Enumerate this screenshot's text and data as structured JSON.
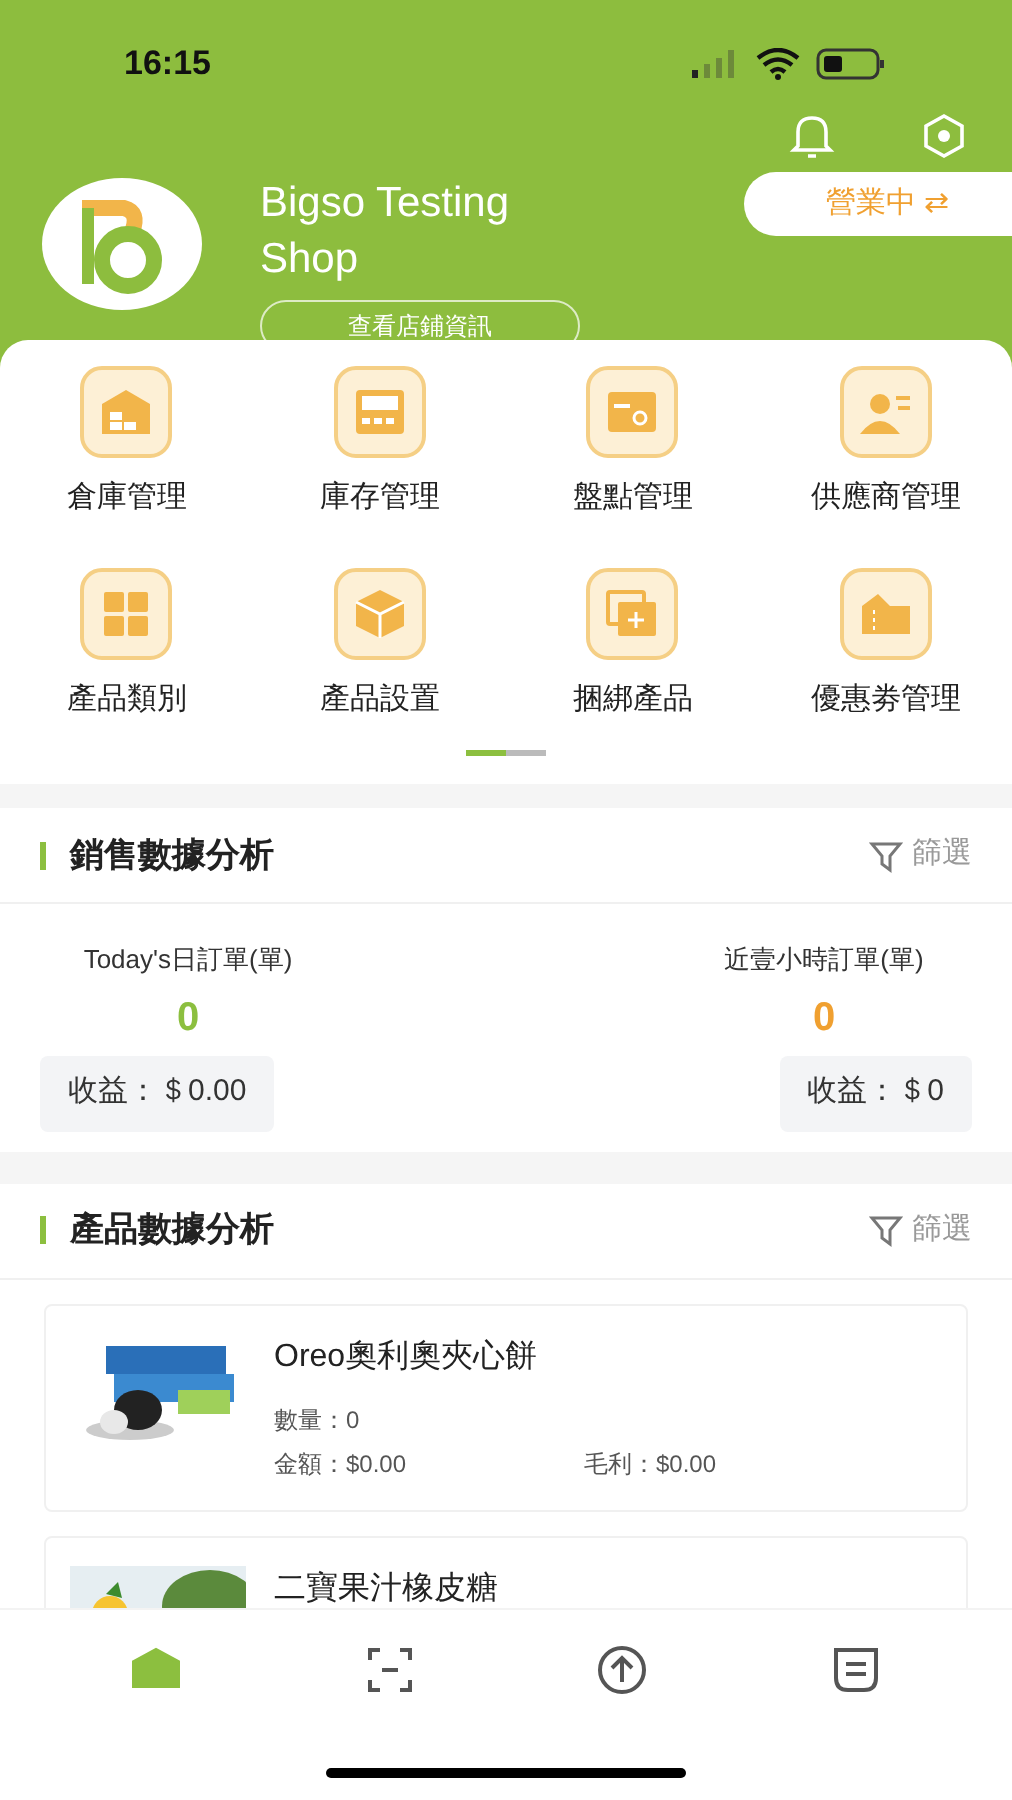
{
  "status_bar": {
    "time": "16:15"
  },
  "header": {
    "shop_name": "Bigso Testing Shop",
    "info_button": "查看店鋪資訊",
    "status_button": "營業中 ⇄"
  },
  "menu": [
    {
      "label": "倉庫管理"
    },
    {
      "label": "庫存管理"
    },
    {
      "label": "盤點管理"
    },
    {
      "label": "供應商管理"
    },
    {
      "label": "產品類別"
    },
    {
      "label": "產品設置"
    },
    {
      "label": "捆綁產品"
    },
    {
      "label": "優惠劵管理"
    }
  ],
  "menu_pages": [
    {
      "selected": true
    },
    {
      "selected": false
    }
  ],
  "sales": {
    "title": "銷售數據分析",
    "filter": "篩選",
    "stats": [
      {
        "label": "Today's日訂單(單)",
        "value": "0",
        "color": "#8cbf3f",
        "revenue": "收益：＄0.00"
      },
      {
        "label": "近壹小時訂單(單)",
        "value": "0",
        "color": "#f0a030",
        "revenue": "收益：＄0"
      }
    ]
  },
  "products": {
    "title": "產品數據分析",
    "filter": "篩選",
    "items": [
      {
        "name": "Oreo奧利奧夾心餅",
        "quantity": "數量：0",
        "amount": "金額：$0.00",
        "profit": "毛利：$0.00"
      },
      {
        "name": "二寶果汁橡皮糖"
      }
    ]
  },
  "tabs": [
    {
      "selected": true
    },
    {
      "selected": false
    },
    {
      "selected": false
    },
    {
      "selected": false
    }
  ]
}
